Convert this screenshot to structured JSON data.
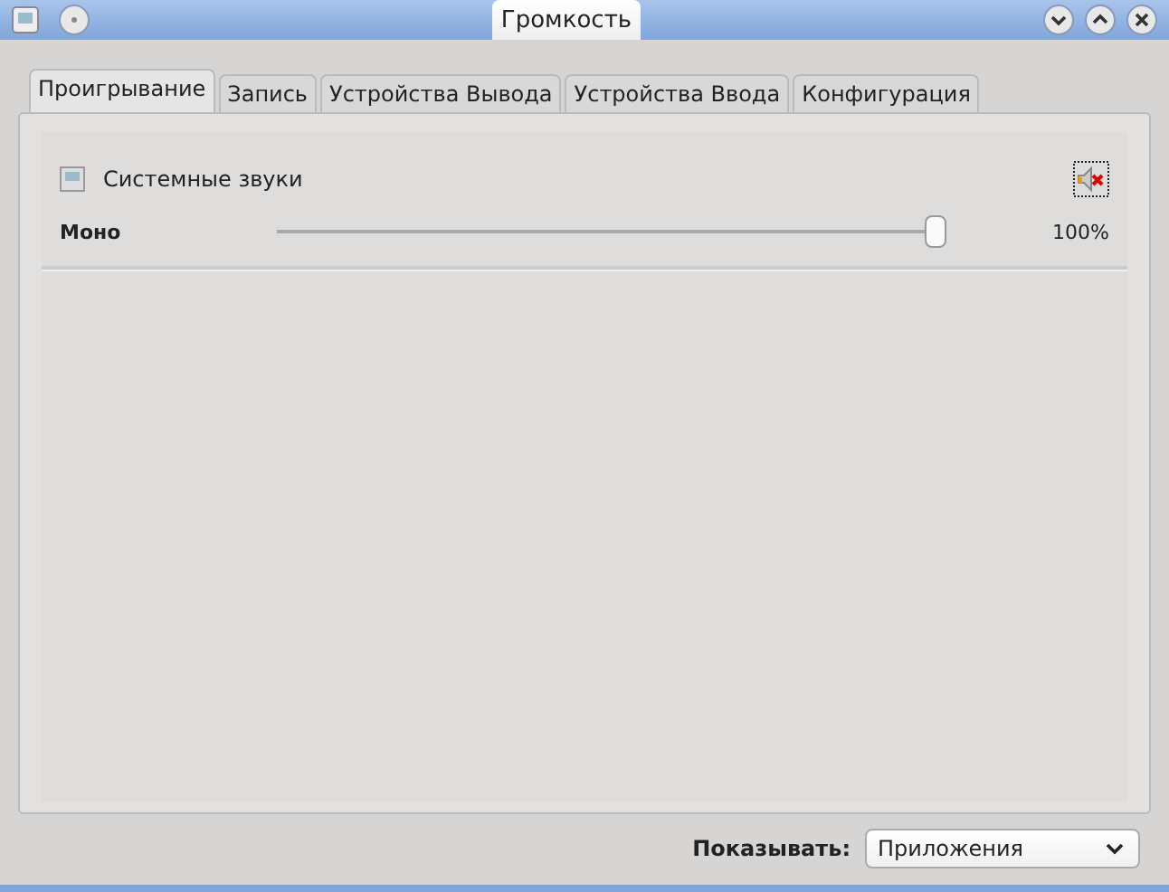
{
  "window": {
    "title": "Громкость"
  },
  "tabs": [
    {
      "label": "Проигрывание",
      "selected": true
    },
    {
      "label": "Запись",
      "selected": false
    },
    {
      "label": "Устройства Вывода",
      "selected": false
    },
    {
      "label": "Устройства Ввода",
      "selected": false
    },
    {
      "label": "Конфигурация",
      "selected": false
    }
  ],
  "stream": {
    "name": "Системные звуки",
    "channel": "Моно",
    "level": 1.0,
    "reading": "100%"
  },
  "footer": {
    "label": "Показывать:",
    "value": "Приложения"
  }
}
